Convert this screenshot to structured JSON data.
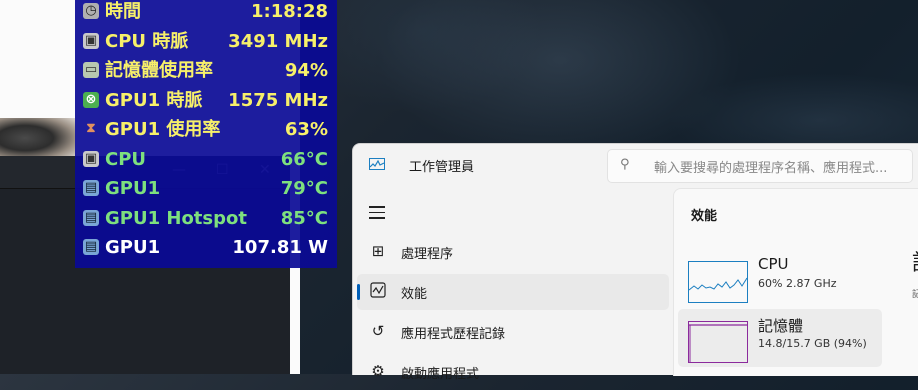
{
  "osd": {
    "rows": [
      {
        "icon": "clock",
        "label": "時間",
        "value": "1:18:28",
        "color": "#f7f06a"
      },
      {
        "icon": "cpu",
        "label": "CPU 時脈",
        "value": "3491 MHz",
        "color": "#f7f06a"
      },
      {
        "icon": "ram",
        "label": "記憶體使用率",
        "value": "94%",
        "color": "#f7f06a"
      },
      {
        "icon": "xbox",
        "label": "GPU1 時脈",
        "value": "1575 MHz",
        "color": "#f7f06a"
      },
      {
        "icon": "hourglass",
        "label": "GPU1 使用率",
        "value": "63%",
        "color": "#f7f06a"
      },
      {
        "icon": "cpu",
        "label": "CPU",
        "value": "66°C",
        "color": "#7ee07e"
      },
      {
        "icon": "gpu",
        "label": "GPU1",
        "value": "79°C",
        "color": "#7ee07e"
      },
      {
        "icon": "gpu",
        "label": "GPU1 Hotspot",
        "value": "85°C",
        "color": "#7ee07e"
      },
      {
        "icon": "gpu",
        "label": "GPU1",
        "value": "107.81 W",
        "color": "#ffffff"
      }
    ]
  },
  "background": {
    "window_controls": [
      "—",
      "☐",
      "✕"
    ]
  },
  "taskmanager": {
    "title": "工作管理員",
    "search_placeholder": "輸入要搜尋的處理程序名稱、應用程式...",
    "nav": [
      {
        "icon": "processes-icon",
        "label": "處理程序",
        "active": false
      },
      {
        "icon": "performance-icon",
        "label": "效能",
        "active": true
      },
      {
        "icon": "app-history-icon",
        "label": "應用程式歷程記錄",
        "active": false
      },
      {
        "icon": "startup-apps-icon",
        "label": "啟動應用程式",
        "active": false
      }
    ],
    "content_title": "效能",
    "cards": [
      {
        "name": "CPU",
        "detail": "60%  2.87 GHz",
        "color": "#1c7fc1",
        "selected": false
      },
      {
        "name": "記憶體",
        "detail": "14.8/15.7 GB (94%)",
        "color": "#8b2a9c",
        "selected": true
      }
    ],
    "right_heading": "記",
    "right_sub": "記"
  }
}
